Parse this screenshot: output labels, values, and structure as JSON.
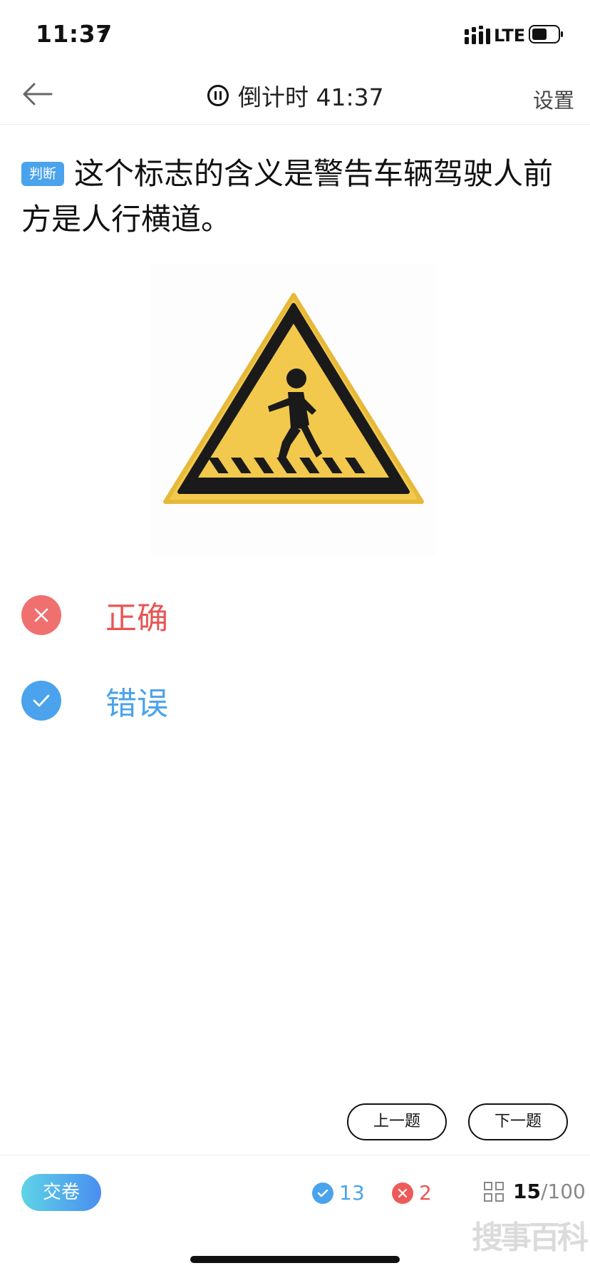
{
  "status_bar": {
    "time": "11:37",
    "network": "LTE"
  },
  "nav": {
    "timer_label": "倒计时 41:37",
    "settings_label": "设置"
  },
  "question": {
    "tag": "判断",
    "text": "这个标志的含义是警告车辆驾驶人前方是人行横道。"
  },
  "options": [
    {
      "label": "正确",
      "state": "wrong",
      "icon": "close-icon"
    },
    {
      "label": "错误",
      "state": "correct",
      "icon": "check-icon"
    }
  ],
  "controls": {
    "prev_label": "上一题",
    "next_label": "下一题"
  },
  "footer": {
    "submit_label": "交卷",
    "correct_count": "13",
    "wrong_count": "2",
    "progress_current": "15",
    "progress_sep": "/",
    "progress_total": "100"
  },
  "watermark": "搜事百科",
  "colors": {
    "accent_blue": "#4aa3ec",
    "error_red": "#e85555",
    "sign_yellow": "#f2c94c"
  }
}
